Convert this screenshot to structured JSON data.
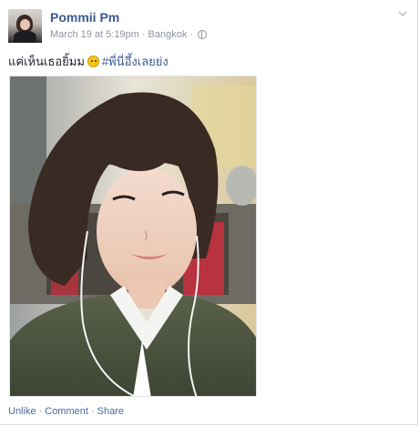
{
  "post": {
    "author": "Pommii Pm",
    "date": "March 19 at 5:19pm",
    "location": "Bangkok",
    "text_before": "แค่เห็นเธอยิ้มม",
    "hashtag": "#พี่นี่อึ้งเลยย่ง",
    "privacy_icon": "globe-icon",
    "menu_icon": "chevron-down-icon",
    "emoji_icon": "smiley-emoji-icon"
  },
  "actions": {
    "unlike": "Unlike",
    "comment": "Comment",
    "share": "Share"
  },
  "colors": {
    "link": "#3b5998",
    "meta": "#90949c",
    "text": "#1d2129"
  }
}
